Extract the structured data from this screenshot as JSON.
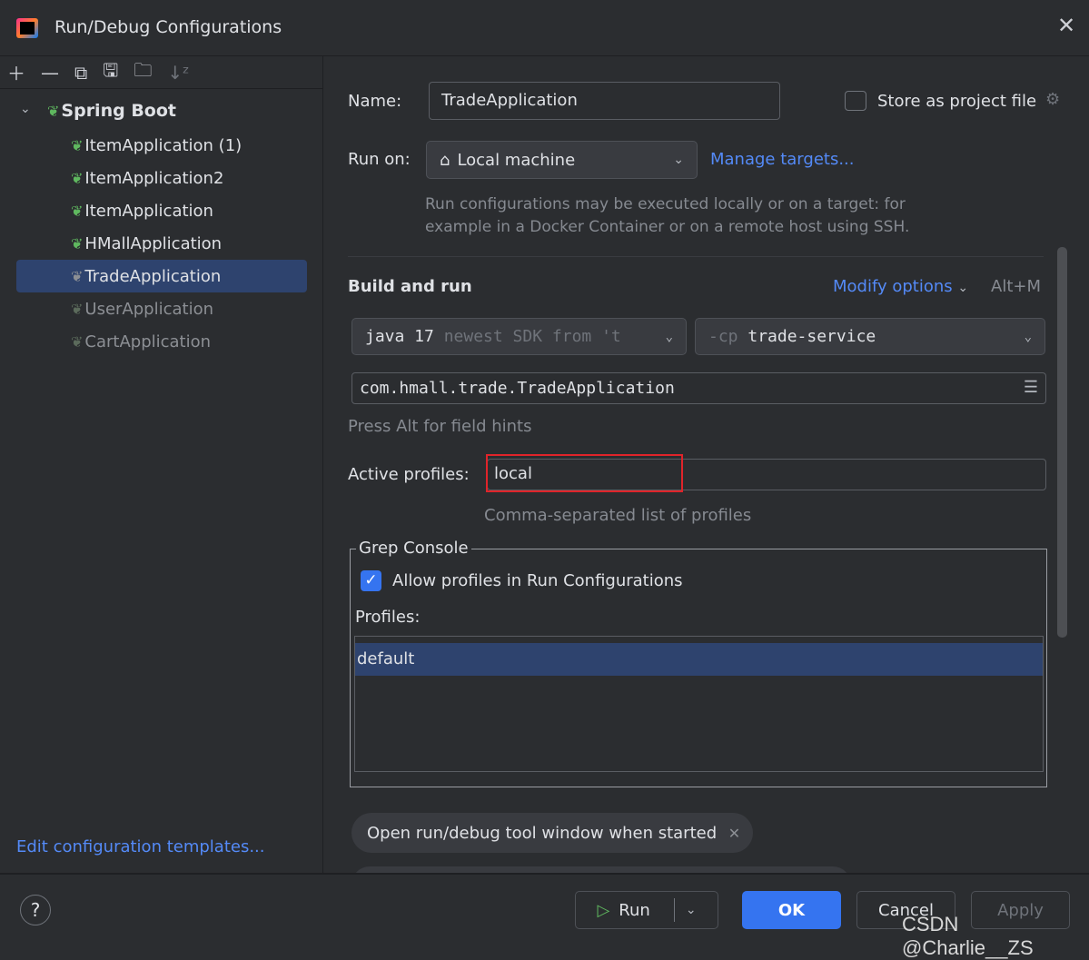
{
  "window": {
    "title": "Run/Debug Configurations",
    "close_icon": "close-icon"
  },
  "toolbar": {
    "icons": [
      "add-icon",
      "remove-icon",
      "copy-icon",
      "save-icon",
      "new-folder-icon",
      "sort-icon"
    ]
  },
  "tree": {
    "group": "Spring Boot",
    "items": [
      {
        "label": "ItemApplication (1)",
        "state": "normal"
      },
      {
        "label": "ItemApplication2",
        "state": "normal"
      },
      {
        "label": "ItemApplication",
        "state": "normal"
      },
      {
        "label": "HMallApplication",
        "state": "normal"
      },
      {
        "label": "TradeApplication",
        "state": "selected"
      },
      {
        "label": "UserApplication",
        "state": "dim"
      },
      {
        "label": "CartApplication",
        "state": "dim"
      }
    ]
  },
  "sidebar": {
    "edit_templates": "Edit configuration templates..."
  },
  "form": {
    "name_label": "Name:",
    "name_value": "TradeApplication",
    "store_label": "Store as project file",
    "store_checked": false,
    "run_on_label": "Run on:",
    "run_on_value": "Local machine",
    "manage_targets": "Manage targets...",
    "run_on_hint_1": "Run configurations may be executed locally or on a target: for",
    "run_on_hint_2": "example in a Docker Container or on a remote host using SSH.",
    "build_run": "Build and run",
    "modify_options": "Modify options",
    "modify_shortcut": "Alt+M",
    "jdk_main": "java 17",
    "jdk_hint": "newest SDK from 't",
    "cp_prefix": "-cp",
    "cp_value": "trade-service",
    "main_class": "com.hmall.trade.TradeApplication",
    "field_hints": "Press Alt for field hints",
    "profiles_label": "Active profiles:",
    "profiles_value": "local",
    "profiles_hint": "Comma-separated list of profiles",
    "grep_title": "Grep Console",
    "grep_allow": "Allow profiles in Run Configurations",
    "grep_allow_checked": true,
    "grep_profiles_label": "Profiles:",
    "grep_profiles": [
      "default"
    ],
    "chip": "Open run/debug tool window when started"
  },
  "footer": {
    "help": "?",
    "run": "Run",
    "ok": "OK",
    "cancel": "Cancel",
    "apply": "Apply"
  },
  "watermark": "CSDN @Charlie__ZS",
  "colors": {
    "accent": "#3574f0",
    "link": "#548af7",
    "selection": "#2e436e",
    "highlight_box": "#e0242a"
  }
}
